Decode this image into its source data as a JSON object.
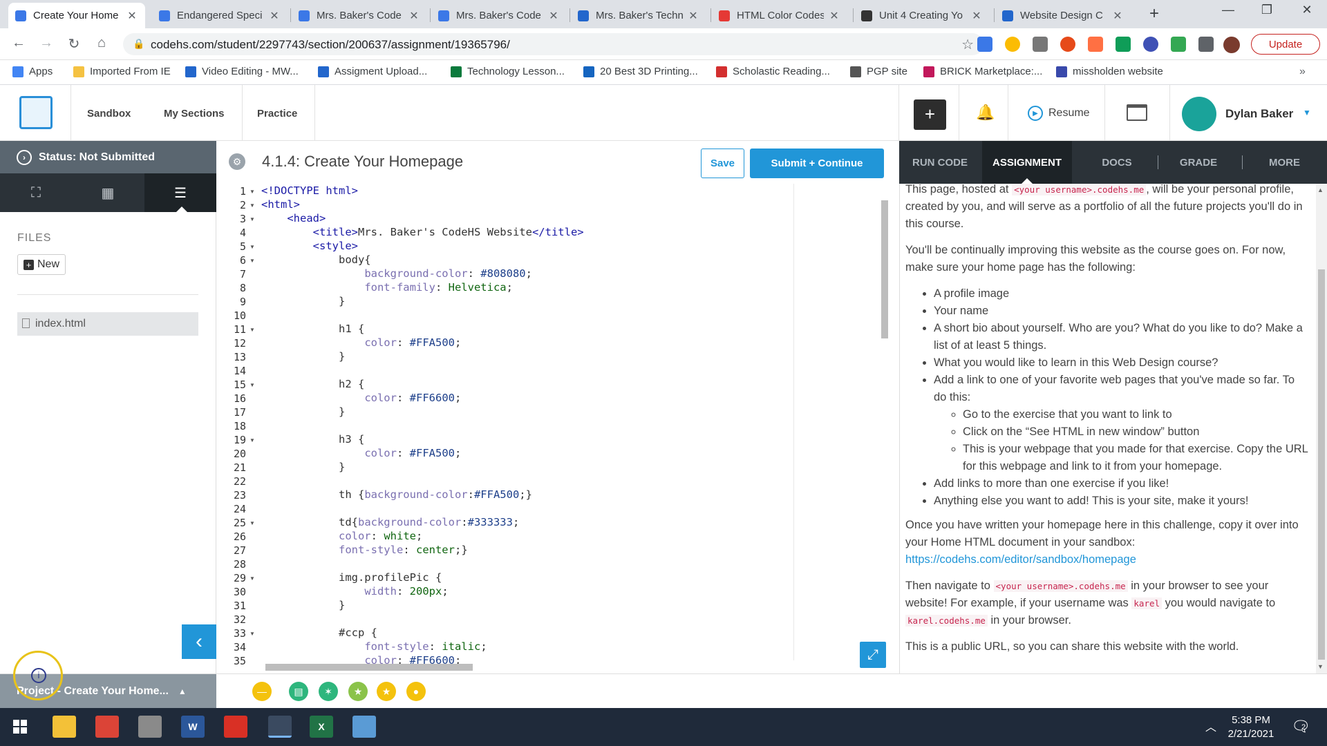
{
  "browser": {
    "tabs": [
      {
        "title": "Create Your Home",
        "active": true,
        "icon": "codehs-icon",
        "color": "#3b78e7"
      },
      {
        "title": "Endangered Speci",
        "active": false,
        "icon": "codehs-icon",
        "color": "#3b78e7"
      },
      {
        "title": "Mrs. Baker's Code",
        "active": false,
        "icon": "codehs-icon",
        "color": "#3b78e7"
      },
      {
        "title": "Mrs. Baker's Code",
        "active": false,
        "icon": "codehs-icon",
        "color": "#3b78e7"
      },
      {
        "title": "Mrs. Baker's Techn",
        "active": false,
        "icon": "weebly-icon",
        "color": "#2266cc"
      },
      {
        "title": "HTML Color Codes",
        "active": false,
        "icon": "colorwheel-icon",
        "color": "#e53935"
      },
      {
        "title": "Unit 4 Creating Yo",
        "active": false,
        "icon": "classroom-icon",
        "color": "#333333"
      },
      {
        "title": "Website Design C",
        "active": false,
        "icon": "docs-icon",
        "color": "#2266cc"
      }
    ],
    "url": "codehs.com/student/2297743/section/200637/assignment/19365796/",
    "update_label": "Update",
    "bookmarks": [
      {
        "label": "Apps",
        "icon": "apps-grid-icon",
        "color": "#4285f4"
      },
      {
        "label": "Imported From IE",
        "icon": "folder-icon",
        "color": "#f5c242"
      },
      {
        "label": "Video Editing - MW...",
        "icon": "page-icon",
        "color": "#2266cc"
      },
      {
        "label": "Assigment Upload...",
        "icon": "page-icon",
        "color": "#2266cc"
      },
      {
        "label": "Technology Lesson...",
        "icon": "globe-icon",
        "color": "#0a7a3c"
      },
      {
        "label": "20 Best 3D Printing...",
        "icon": "3d-icon",
        "color": "#1565c0"
      },
      {
        "label": "Scholastic Reading...",
        "icon": "scholastic-icon",
        "color": "#d32f2f"
      },
      {
        "label": "PGP site",
        "icon": "globe-icon",
        "color": "#555555"
      },
      {
        "label": "BRICK Marketplace:...",
        "icon": "brick-icon",
        "color": "#c2185b"
      },
      {
        "label": "missholden website",
        "icon": "page-icon",
        "color": "#3949ab"
      }
    ]
  },
  "nav": {
    "links": [
      "Sandbox",
      "My Sections",
      "Practice"
    ],
    "plus_label": "+",
    "resume_label": "Resume",
    "user_name": "Dylan Baker"
  },
  "sidebar": {
    "status": "Status: Not Submitted",
    "files_label": "FILES",
    "new_label": "New",
    "file_name": "index.html",
    "project_label": "Project - Create Your Home..."
  },
  "editor": {
    "title": "4.1.4: Create Your Homepage",
    "save_label": "Save",
    "submit_label": "Submit + Continue",
    "lines": [
      "<!DOCTYPE html>",
      "<html>",
      "    <head>",
      "        <title>Mrs. Baker's CodeHS Website</title>",
      "        <style>",
      "            body{",
      "                background-color: #808080;",
      "                font-family: Helvetica;",
      "            }",
      "",
      "            h1 {",
      "                color: #FFA500;",
      "            }",
      "",
      "            h2 {",
      "                color: #FF6600;",
      "            }",
      "",
      "            h3 {",
      "                color: #FFA500;",
      "            }",
      "",
      "            th {background-color:#FFA500;}",
      "",
      "            td{background-color:#333333;",
      "            color: white;",
      "            font-style: center;}",
      "",
      "            img.profilePic {",
      "                width: 200px;",
      "            }",
      "",
      "            #ccp {",
      "                font-style: italic;",
      "                color: #FF6600;"
    ],
    "fold_lines": [
      1,
      2,
      3,
      5,
      6,
      11,
      15,
      19,
      25,
      29,
      33
    ]
  },
  "right_panel": {
    "tabs": [
      "RUN CODE",
      "ASSIGNMENT",
      "DOCS",
      "GRADE",
      "MORE"
    ],
    "active_tab": "ASSIGNMENT",
    "p1_a": "This page, hosted at ",
    "p1_code": "<your username>.codehs.me",
    "p1_b": ", will be your personal profile, created by you, and will serve as a portfolio of all the future projects you'll do in this course.",
    "p2": "You'll be continually improving this website as the course goes on. For now, make sure your home page has the following:",
    "bullets": [
      "A profile image",
      "Your name",
      "A short bio about yourself. Who are you? What do you like to do? Make a list of at least 5 things.",
      "What you would like to learn in this Web Design course?",
      "Add a link to one of your favorite web pages that you've made so far. To do this:"
    ],
    "sub_bullets": [
      "Go to the exercise that you want to link to",
      "Click on the “See HTML in new window” button",
      "This is your webpage that you made for that exercise. Copy the URL for this webpage and link to it from your homepage."
    ],
    "bullets_after": [
      "Add links to more than one exercise if you like!",
      "Anything else you want to add! This is your site, make it yours!"
    ],
    "p3": "Once you have written your homepage here in this challenge, copy it over into your Home HTML document in your sandbox:",
    "p3_link": "https://codehs.com/editor/sandbox/homepage",
    "p4_a": "Then navigate to ",
    "p4_code1": "<your username>.codehs.me",
    "p4_b": " in your browser to see your website! For example, if your username was ",
    "p4_code2": "karel",
    "p4_c": " you would navigate to ",
    "p4_code3": "karel.codehs.me",
    "p4_d": " in your browser.",
    "p5": "This is a public URL, so you can share this website with the world."
  },
  "taskbar": {
    "time": "5:38 PM",
    "date": "2/21/2021",
    "notification_count": "2",
    "apps": [
      {
        "name": "windows-start-icon",
        "label": "",
        "color": "#1f2a3a"
      },
      {
        "name": "file-explorer-icon",
        "label": "",
        "color": "#f3c138"
      },
      {
        "name": "chrome-icon",
        "label": "",
        "color": "#db4437"
      },
      {
        "name": "media-icon",
        "label": "",
        "color": "#8a8a8a"
      },
      {
        "name": "word-icon",
        "label": "W",
        "color": "#2b579a"
      },
      {
        "name": "acrobat-icon",
        "label": "",
        "color": "#d93025"
      },
      {
        "name": "screen-recorder-icon",
        "label": "",
        "color": "#3a4a60"
      },
      {
        "name": "excel-icon",
        "label": "X",
        "color": "#217346"
      },
      {
        "name": "paint-icon",
        "label": "",
        "color": "#5a9bd5"
      }
    ]
  },
  "toolbar_circles": [
    {
      "name": "minimize-circle-icon",
      "color": "#f4c20d",
      "glyph": "—"
    },
    {
      "name": "docs-circle-icon",
      "color": "#2eb67d",
      "glyph": "▤"
    },
    {
      "name": "hint-circle-icon",
      "color": "#2eb67d",
      "glyph": "✶"
    },
    {
      "name": "star-circle-icon",
      "color": "#8bc34a",
      "glyph": "★"
    },
    {
      "name": "gold-star-circle-icon",
      "color": "#f4c20d",
      "glyph": "★"
    },
    {
      "name": "yellow-circle-icon",
      "color": "#f4c20d",
      "glyph": "●"
    }
  ]
}
